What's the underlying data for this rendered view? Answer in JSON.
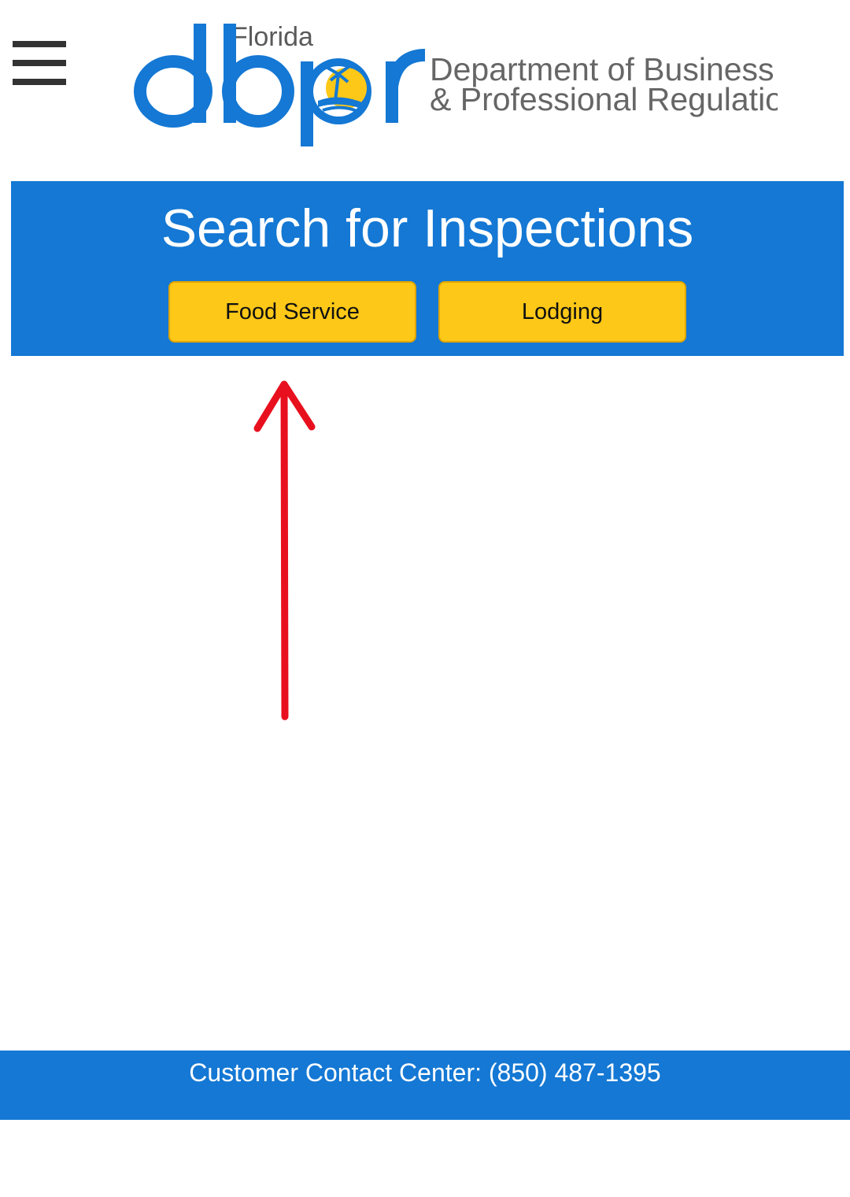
{
  "header": {
    "menu_icon": "hamburger-menu-icon",
    "logo": {
      "state": "Florida",
      "wordmark": "dbpr",
      "dept_line1": "Department of Business",
      "dept_line2": "& Professional Regulation",
      "brand_blue": "#1478d4",
      "sun_yellow": "#fdc817"
    }
  },
  "banner": {
    "title": "Search for Inspections",
    "background": "#1478d4",
    "buttons": [
      {
        "label": "Food Service"
      },
      {
        "label": "Lodging"
      }
    ],
    "button_color": "#fdc817"
  },
  "annotation": {
    "arrow_color": "#e8101e",
    "icon": "up-arrow-icon"
  },
  "footer": {
    "contact": "Customer Contact Center: (850) 487-1395",
    "background": "#1478d4"
  }
}
